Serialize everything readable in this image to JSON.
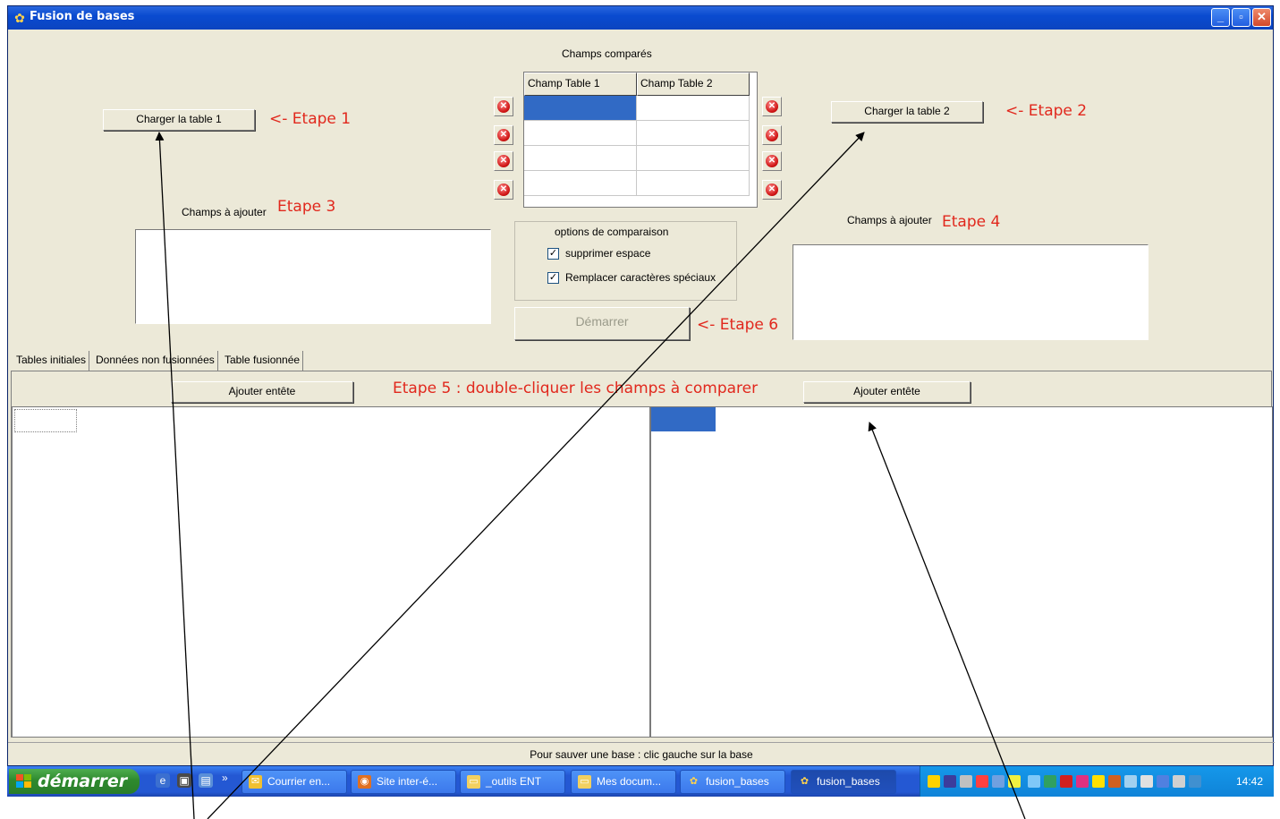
{
  "window": {
    "title": "Fusion de bases",
    "controls": [
      "_",
      "▫",
      "✕"
    ]
  },
  "top": {
    "load_table1": "Charger la table 1",
    "load_table2": "Charger la table 2",
    "step1": "<- Etape 1",
    "step2": "<- Etape 2",
    "fields_compared_label": "Champs comparés",
    "grid_headers": [
      "Champ Table 1",
      "Champ Table 2"
    ],
    "fields_to_add_left": "Champs à ajouter",
    "step3": "Etape 3",
    "fields_to_add_right": "Champs à ajouter",
    "step4": "Etape 4",
    "options_title": "options de comparaison",
    "opt_remove_space": "supprimer espace",
    "opt_replace_special": "Remplacer caractères spéciaux",
    "opt_remove_space_checked": true,
    "opt_replace_special_checked": true,
    "start_button": "Démarrer",
    "step6": "<- Etape 6"
  },
  "tabs": [
    "Tables initiales",
    "Données non fusionnées",
    "Table fusionnée"
  ],
  "lower": {
    "add_header_left": "Ajouter entête",
    "add_header_right": "Ajouter entête",
    "step5": "Etape 5 : double-cliquer les champs à comparer"
  },
  "status": "Pour sauver une base : clic gauche sur la base",
  "taskbar": {
    "start": "démarrer",
    "quicklaunch_more": "»",
    "tasks": [
      "Courrier en...",
      "Site inter-é...",
      "_outils ENT",
      "Mes docum...",
      "fusion_bases",
      "fusion_bases"
    ],
    "clock": "14:42"
  },
  "colors": {
    "accent_step": "#e1281d",
    "selected_cell": "#316ac5",
    "titlebar": "#0a4bd0",
    "face": "#ece9d8"
  }
}
